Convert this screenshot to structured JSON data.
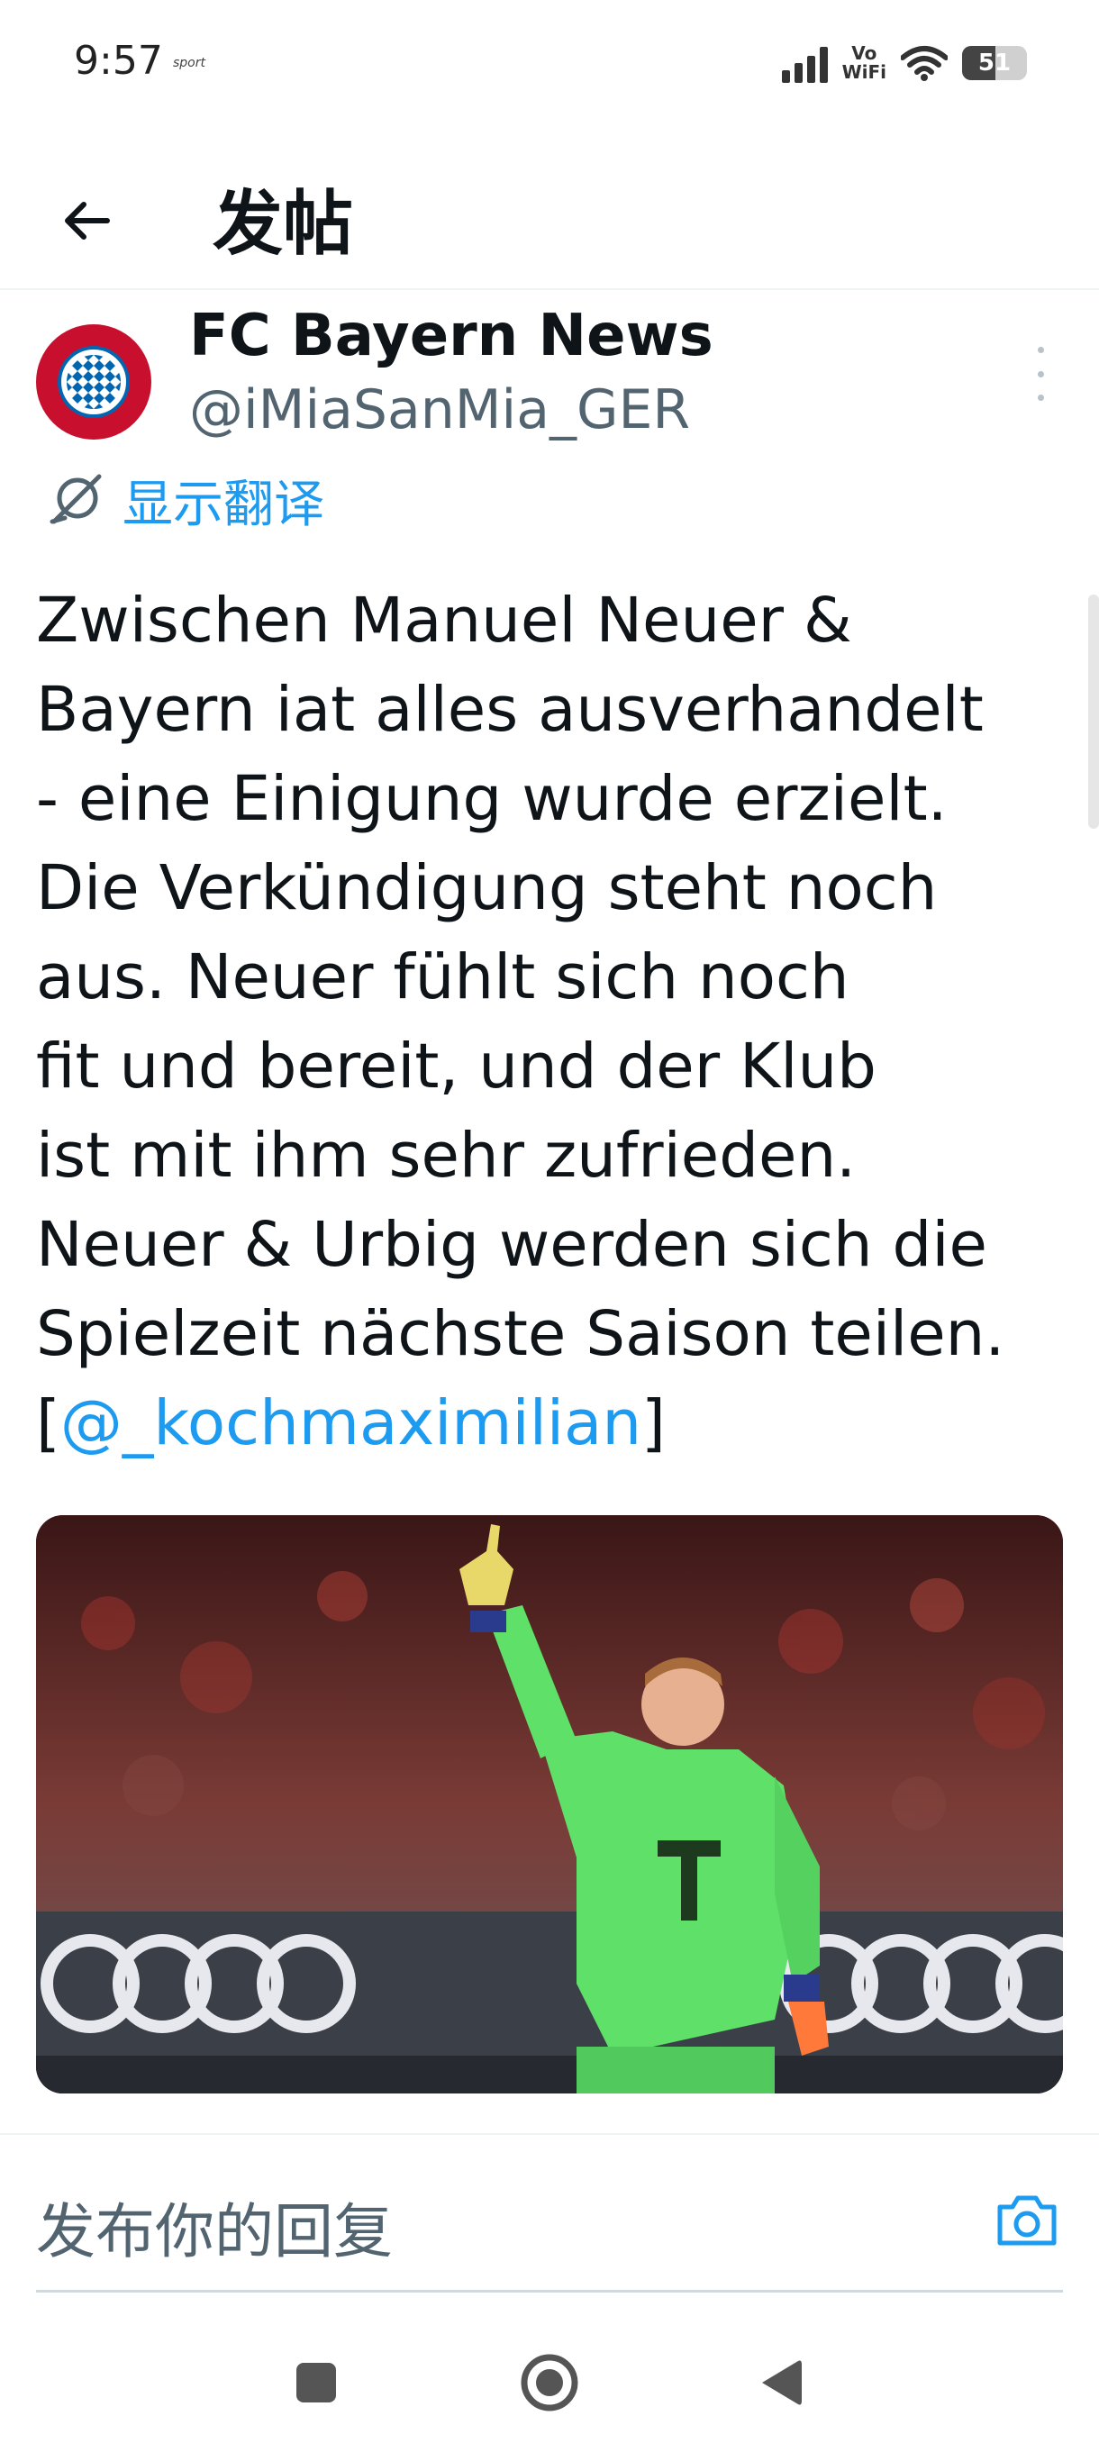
{
  "status_bar": {
    "time": "9:57",
    "app_badge": "sport",
    "network_label_top": "Vo",
    "network_label_bottom": "WiFi",
    "battery_level": 51,
    "battery_text": "51"
  },
  "header": {
    "back_icon": "arrow-left-icon",
    "title": "发帖"
  },
  "tweet": {
    "author_name": "FC Bayern News",
    "handle": "@iMiaSanMia_GER",
    "avatar_icon": "fc-bayern-logo",
    "translate_label": "显示翻译",
    "body_lines": [
      "Zwischen Manuel Neuer &",
      "Bayern iat alles ausverhandelt",
      "- eine Einigung wurde erzielt.",
      "Die Verkündigung steht noch",
      "aus. Neuer fühlt sich noch",
      "fit und bereit, und der Klub",
      "ist mit ihm sehr zufrieden.",
      "Neuer & Urbig werden sich die",
      "Spielzeit nächste Saison teilen."
    ],
    "mention_open": "[",
    "mention": "@_kochmaximilian",
    "mention_close": "]",
    "media_description_icon": "photo-goalkeeper"
  },
  "reply": {
    "placeholder": "发布你的回复",
    "camera_icon": "camera-icon"
  },
  "nav_bar": {
    "recents_icon": "square-icon",
    "home_icon": "circle-home-icon",
    "back_icon": "triangle-back-icon"
  },
  "colors": {
    "accent": "#1d9bf0",
    "text_primary": "#0f1419",
    "text_secondary": "#536471",
    "goalkeeper_kit": "#5fe069"
  }
}
